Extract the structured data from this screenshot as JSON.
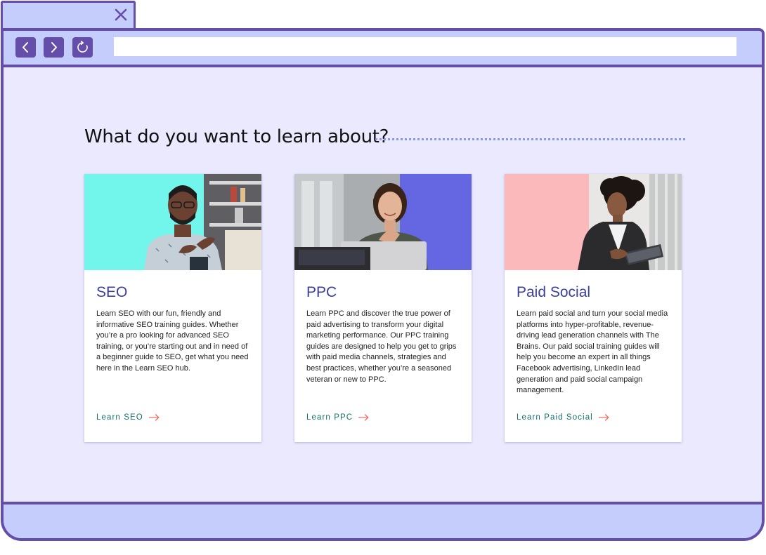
{
  "browser": {
    "tab_title": "",
    "url": "",
    "icons": {
      "close": "close-icon",
      "back": "chevron-left-icon",
      "forward": "chevron-right-icon",
      "reload": "reload-icon"
    }
  },
  "page": {
    "heading": "What do you want to learn about?",
    "cards": [
      {
        "title": "SEO",
        "description": "Learn SEO with our fun, friendly and informative SEO training guides. Whether you’re a pro looking for advanced SEO training, or you’re starting out and in need of a beginner guide to SEO, get what you need here in the Learn SEO hub.",
        "link_label": "Learn SEO",
        "image_bg": "#72f5ea"
      },
      {
        "title": "PPC",
        "description": "Learn PPC and discover the true power of paid advertising to transform your digital marketing performance. Our PPC training guides are designed to help you get to grips with paid media channels, strategies and best practices, whether you’re a seasoned veteran or new to PPC.",
        "link_label": "Learn PPC",
        "image_bg": "#6466e2"
      },
      {
        "title": "Paid Social",
        "description": "Learn paid social and turn your social media platforms into hyper-profitable, revenue-driving lead generation channels with The Brains. Our paid social training guides will help you become an expert in all things Facebook advertising, LinkedIn lead generation and paid social campaign management.",
        "link_label": "Learn Paid Social",
        "image_bg": "#fbb9bb"
      }
    ]
  },
  "colors": {
    "frame": "#654eaa",
    "chrome": "#c4cdfb",
    "page_bg": "#eae9fe",
    "title": "#3b3f9e",
    "link": "#136f6b",
    "arrow": "#f06d6d"
  }
}
